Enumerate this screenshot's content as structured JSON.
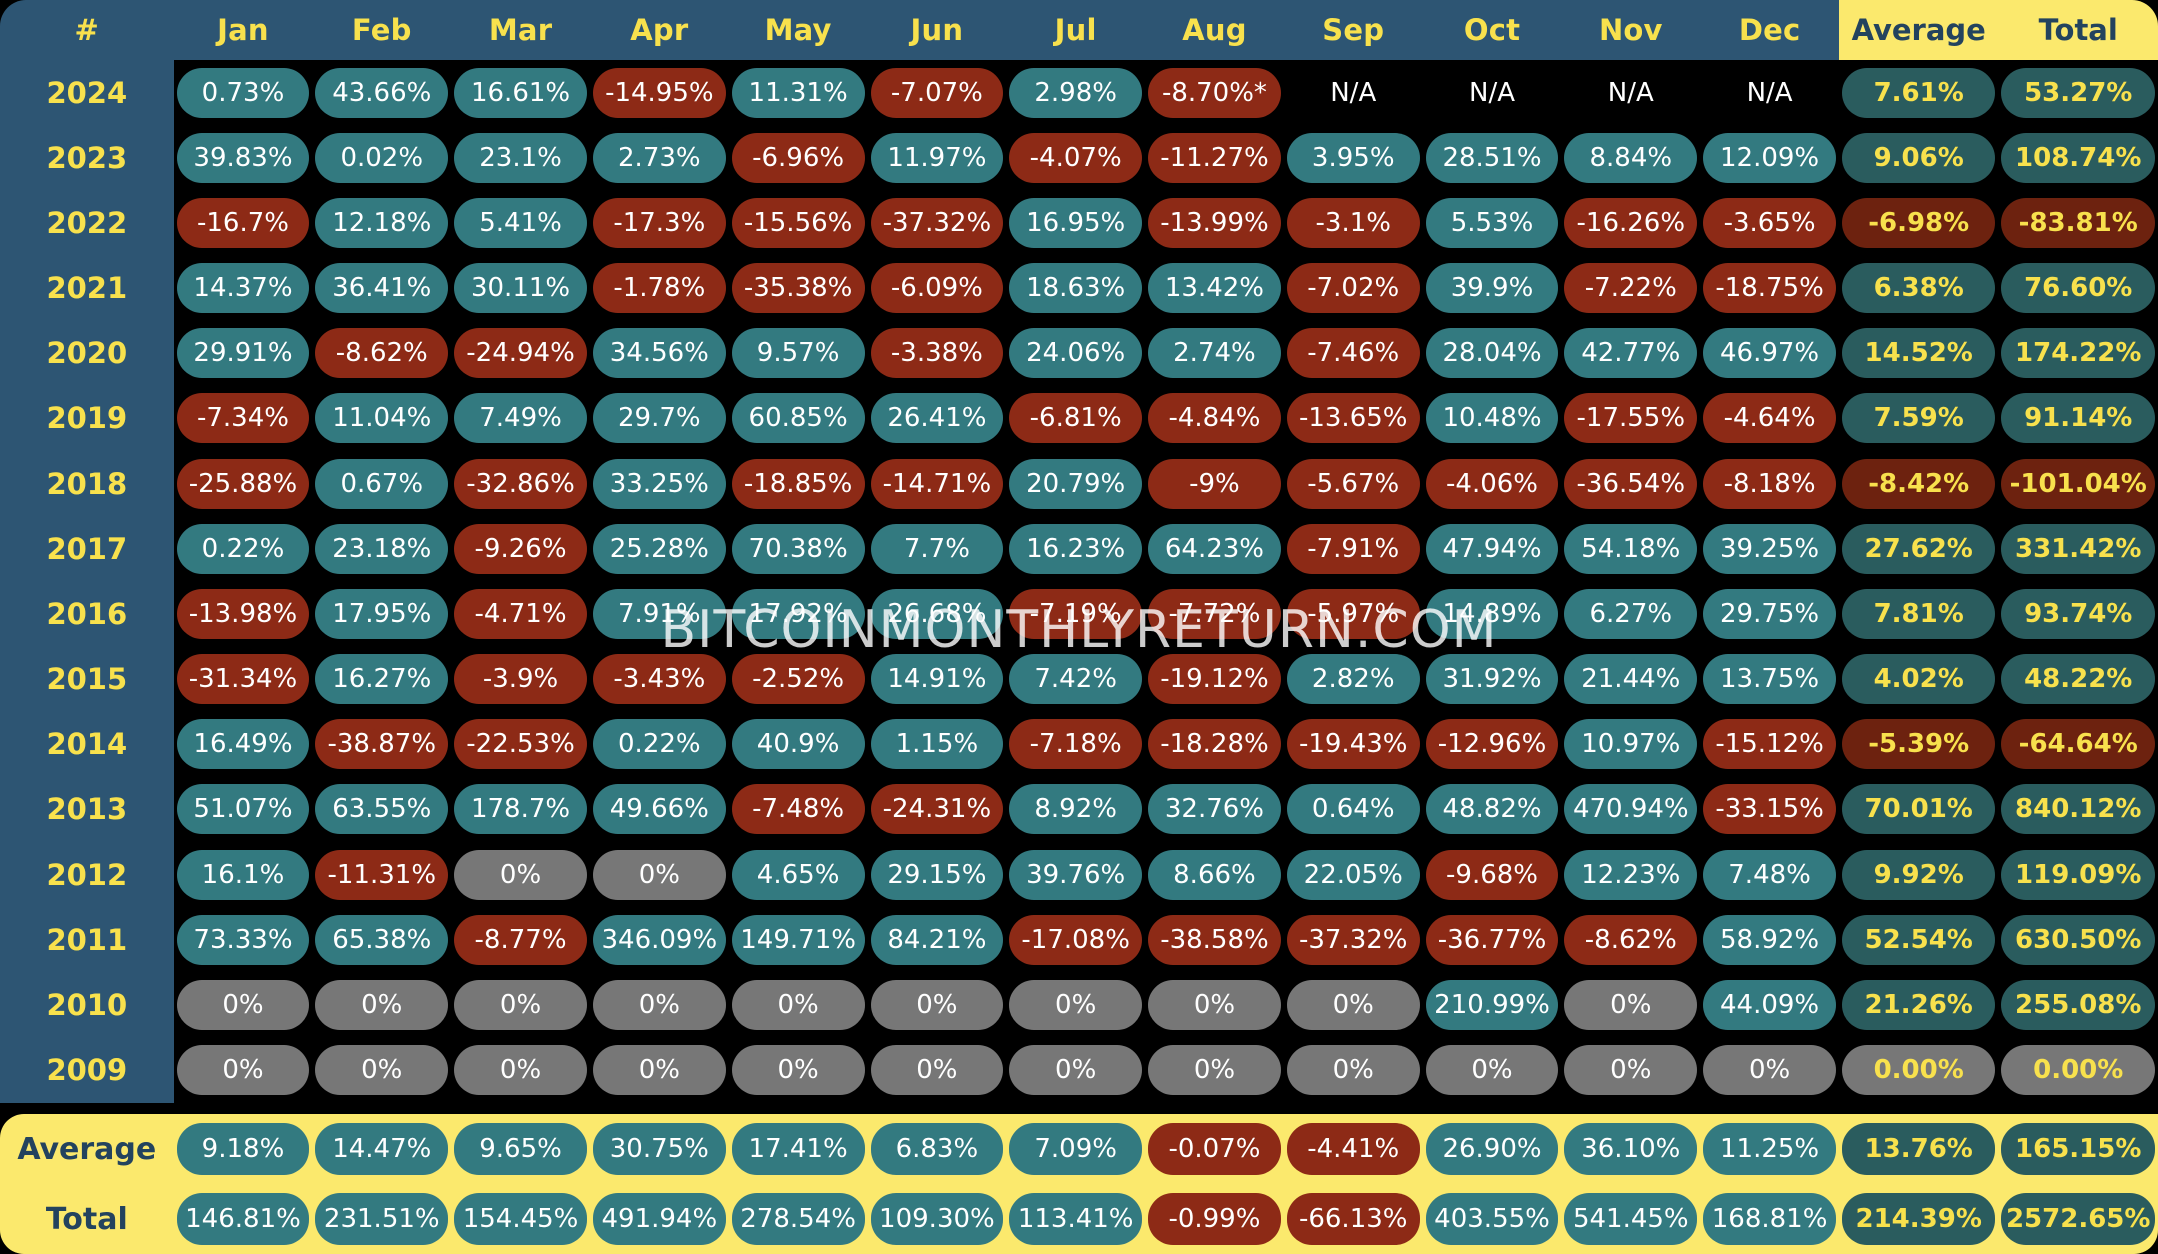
{
  "watermark": "BITCOINMONTHLYRETURN.COM",
  "header": {
    "index_label": "#",
    "months": [
      "Jan",
      "Feb",
      "Mar",
      "Apr",
      "May",
      "Jun",
      "Jul",
      "Aug",
      "Sep",
      "Oct",
      "Nov",
      "Dec"
    ],
    "average_label": "Average",
    "total_label": "Total"
  },
  "colors": {
    "positive": "#337a80",
    "negative": "#8d2a16",
    "zero": "#777777",
    "header_blue": "#2d5573",
    "header_yellow": "#fbe96d",
    "accent_yellow": "#f8e14d",
    "summary_positive": "#2a5c5e",
    "summary_negative": "#6d220f",
    "background": "#000000"
  },
  "footer": {
    "average_label": "Average",
    "total_label": "Total",
    "average": [
      "9.18%",
      "14.47%",
      "9.65%",
      "30.75%",
      "17.41%",
      "6.83%",
      "7.09%",
      "-0.07%",
      "-4.41%",
      "26.90%",
      "36.10%",
      "11.25%"
    ],
    "average_avg": "13.76%",
    "average_total": "165.15%",
    "total": [
      "146.81%",
      "231.51%",
      "154.45%",
      "491.94%",
      "278.54%",
      "109.30%",
      "113.41%",
      "-0.99%",
      "-66.13%",
      "403.55%",
      "541.45%",
      "168.81%"
    ],
    "total_avg": "214.39%",
    "total_total": "2572.65%"
  },
  "rows": [
    {
      "year": "2024",
      "values": [
        "0.73%",
        "43.66%",
        "16.61%",
        "-14.95%",
        "11.31%",
        "-7.07%",
        "2.98%",
        "-8.70%*",
        "N/A",
        "N/A",
        "N/A",
        "N/A"
      ],
      "average": "7.61%",
      "total": "53.27%"
    },
    {
      "year": "2023",
      "values": [
        "39.83%",
        "0.02%",
        "23.1%",
        "2.73%",
        "-6.96%",
        "11.97%",
        "-4.07%",
        "-11.27%",
        "3.95%",
        "28.51%",
        "8.84%",
        "12.09%"
      ],
      "average": "9.06%",
      "total": "108.74%"
    },
    {
      "year": "2022",
      "values": [
        "-16.7%",
        "12.18%",
        "5.41%",
        "-17.3%",
        "-15.56%",
        "-37.32%",
        "16.95%",
        "-13.99%",
        "-3.1%",
        "5.53%",
        "-16.26%",
        "-3.65%"
      ],
      "average": "-6.98%",
      "total": "-83.81%"
    },
    {
      "year": "2021",
      "values": [
        "14.37%",
        "36.41%",
        "30.11%",
        "-1.78%",
        "-35.38%",
        "-6.09%",
        "18.63%",
        "13.42%",
        "-7.02%",
        "39.9%",
        "-7.22%",
        "-18.75%"
      ],
      "average": "6.38%",
      "total": "76.60%"
    },
    {
      "year": "2020",
      "values": [
        "29.91%",
        "-8.62%",
        "-24.94%",
        "34.56%",
        "9.57%",
        "-3.38%",
        "24.06%",
        "2.74%",
        "-7.46%",
        "28.04%",
        "42.77%",
        "46.97%"
      ],
      "average": "14.52%",
      "total": "174.22%"
    },
    {
      "year": "2019",
      "values": [
        "-7.34%",
        "11.04%",
        "7.49%",
        "29.7%",
        "60.85%",
        "26.41%",
        "-6.81%",
        "-4.84%",
        "-13.65%",
        "10.48%",
        "-17.55%",
        "-4.64%"
      ],
      "average": "7.59%",
      "total": "91.14%"
    },
    {
      "year": "2018",
      "values": [
        "-25.88%",
        "0.67%",
        "-32.86%",
        "33.25%",
        "-18.85%",
        "-14.71%",
        "20.79%",
        "-9%",
        "-5.67%",
        "-4.06%",
        "-36.54%",
        "-8.18%"
      ],
      "average": "-8.42%",
      "total": "-101.04%"
    },
    {
      "year": "2017",
      "values": [
        "0.22%",
        "23.18%",
        "-9.26%",
        "25.28%",
        "70.38%",
        "7.7%",
        "16.23%",
        "64.23%",
        "-7.91%",
        "47.94%",
        "54.18%",
        "39.25%"
      ],
      "average": "27.62%",
      "total": "331.42%"
    },
    {
      "year": "2016",
      "values": [
        "-13.98%",
        "17.95%",
        "-4.71%",
        "7.91%",
        "17.92%",
        "26.68%",
        "-7.19%",
        "-7.72%",
        "-5.97%",
        "14.89%",
        "6.27%",
        "29.75%"
      ],
      "average": "7.81%",
      "total": "93.74%"
    },
    {
      "year": "2015",
      "values": [
        "-31.34%",
        "16.27%",
        "-3.9%",
        "-3.43%",
        "-2.52%",
        "14.91%",
        "7.42%",
        "-19.12%",
        "2.82%",
        "31.92%",
        "21.44%",
        "13.75%"
      ],
      "average": "4.02%",
      "total": "48.22%"
    },
    {
      "year": "2014",
      "values": [
        "16.49%",
        "-38.87%",
        "-22.53%",
        "0.22%",
        "40.9%",
        "1.15%",
        "-7.18%",
        "-18.28%",
        "-19.43%",
        "-12.96%",
        "10.97%",
        "-15.12%"
      ],
      "average": "-5.39%",
      "total": "-64.64%"
    },
    {
      "year": "2013",
      "values": [
        "51.07%",
        "63.55%",
        "178.7%",
        "49.66%",
        "-7.48%",
        "-24.31%",
        "8.92%",
        "32.76%",
        "0.64%",
        "48.82%",
        "470.94%",
        "-33.15%"
      ],
      "average": "70.01%",
      "total": "840.12%"
    },
    {
      "year": "2012",
      "values": [
        "16.1%",
        "-11.31%",
        "0%",
        "0%",
        "4.65%",
        "29.15%",
        "39.76%",
        "8.66%",
        "22.05%",
        "-9.68%",
        "12.23%",
        "7.48%"
      ],
      "average": "9.92%",
      "total": "119.09%"
    },
    {
      "year": "2011",
      "values": [
        "73.33%",
        "65.38%",
        "-8.77%",
        "346.09%",
        "149.71%",
        "84.21%",
        "-17.08%",
        "-38.58%",
        "-37.32%",
        "-36.77%",
        "-8.62%",
        "58.92%"
      ],
      "average": "52.54%",
      "total": "630.50%"
    },
    {
      "year": "2010",
      "values": [
        "0%",
        "0%",
        "0%",
        "0%",
        "0%",
        "0%",
        "0%",
        "0%",
        "0%",
        "210.99%",
        "0%",
        "44.09%"
      ],
      "average": "21.26%",
      "total": "255.08%"
    },
    {
      "year": "2009",
      "values": [
        "0%",
        "0%",
        "0%",
        "0%",
        "0%",
        "0%",
        "0%",
        "0%",
        "0%",
        "0%",
        "0%",
        "0%"
      ],
      "average": "0.00%",
      "total": "0.00%"
    }
  ]
}
